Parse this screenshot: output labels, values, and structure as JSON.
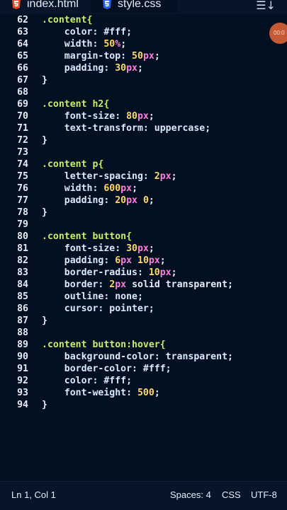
{
  "tabs": [
    {
      "label": "index.html",
      "icon": "html5-icon",
      "active": false
    },
    {
      "label": "style.css",
      "icon": "css3-icon",
      "active": true
    }
  ],
  "colors": {
    "html_icon": "#e44d26",
    "css_icon": "#2965f1",
    "selector": "#c6ef71",
    "number": "#ffd866",
    "unit": "#ff7edb",
    "record": "#c65a34"
  },
  "recording": {
    "time": "00:0"
  },
  "code": [
    {
      "n": "62",
      "tokens": [
        {
          "t": ".content{",
          "c": "sel"
        }
      ]
    },
    {
      "n": "63",
      "tokens": [
        {
          "t": "    color: #fff;",
          "c": "prop"
        }
      ]
    },
    {
      "n": "64",
      "tokens": [
        {
          "t": "    width: ",
          "c": "prop"
        },
        {
          "t": "50",
          "c": "num"
        },
        {
          "t": "%",
          "c": "unit"
        },
        {
          "t": ";",
          "c": "punc"
        }
      ]
    },
    {
      "n": "65",
      "tokens": [
        {
          "t": "    margin-top: ",
          "c": "prop"
        },
        {
          "t": "50",
          "c": "num"
        },
        {
          "t": "px",
          "c": "unit"
        },
        {
          "t": ";",
          "c": "punc"
        }
      ]
    },
    {
      "n": "66",
      "tokens": [
        {
          "t": "    padding: ",
          "c": "prop"
        },
        {
          "t": "30",
          "c": "num"
        },
        {
          "t": "px",
          "c": "unit"
        },
        {
          "t": ";",
          "c": "punc"
        }
      ]
    },
    {
      "n": "67",
      "tokens": [
        {
          "t": "}",
          "c": "punc"
        }
      ]
    },
    {
      "n": "68",
      "tokens": []
    },
    {
      "n": "69",
      "tokens": [
        {
          "t": ".content h2{",
          "c": "sel"
        }
      ]
    },
    {
      "n": "70",
      "tokens": [
        {
          "t": "    font-size: ",
          "c": "prop"
        },
        {
          "t": "80",
          "c": "num"
        },
        {
          "t": "px",
          "c": "unit"
        },
        {
          "t": ";",
          "c": "punc"
        }
      ]
    },
    {
      "n": "71",
      "tokens": [
        {
          "t": "    text-transform: uppercase;",
          "c": "prop"
        }
      ]
    },
    {
      "n": "72",
      "tokens": [
        {
          "t": "}",
          "c": "punc"
        }
      ]
    },
    {
      "n": "73",
      "tokens": []
    },
    {
      "n": "74",
      "tokens": [
        {
          "t": ".content p{",
          "c": "sel"
        }
      ]
    },
    {
      "n": "75",
      "tokens": [
        {
          "t": "    letter-spacing: ",
          "c": "prop"
        },
        {
          "t": "2",
          "c": "num"
        },
        {
          "t": "px",
          "c": "unit"
        },
        {
          "t": ";",
          "c": "punc"
        }
      ]
    },
    {
      "n": "76",
      "tokens": [
        {
          "t": "    width: ",
          "c": "prop"
        },
        {
          "t": "600",
          "c": "num"
        },
        {
          "t": "px",
          "c": "unit"
        },
        {
          "t": ";",
          "c": "punc"
        }
      ]
    },
    {
      "n": "77",
      "tokens": [
        {
          "t": "    padding: ",
          "c": "prop"
        },
        {
          "t": "20",
          "c": "num"
        },
        {
          "t": "px",
          "c": "unit"
        },
        {
          "t": " ",
          "c": "punc"
        },
        {
          "t": "0",
          "c": "num"
        },
        {
          "t": ";",
          "c": "punc"
        }
      ]
    },
    {
      "n": "78",
      "tokens": [
        {
          "t": "}",
          "c": "punc"
        }
      ]
    },
    {
      "n": "79",
      "tokens": []
    },
    {
      "n": "80",
      "tokens": [
        {
          "t": ".content button{",
          "c": "sel"
        }
      ]
    },
    {
      "n": "81",
      "tokens": [
        {
          "t": "    font-size: ",
          "c": "prop"
        },
        {
          "t": "30",
          "c": "num"
        },
        {
          "t": "px",
          "c": "unit"
        },
        {
          "t": ";",
          "c": "punc"
        }
      ]
    },
    {
      "n": "82",
      "tokens": [
        {
          "t": "    padding: ",
          "c": "prop"
        },
        {
          "t": "6",
          "c": "num"
        },
        {
          "t": "px",
          "c": "unit"
        },
        {
          "t": " ",
          "c": "punc"
        },
        {
          "t": "10",
          "c": "num"
        },
        {
          "t": "px",
          "c": "unit"
        },
        {
          "t": ";",
          "c": "punc"
        }
      ]
    },
    {
      "n": "83",
      "tokens": [
        {
          "t": "    border-radius: ",
          "c": "prop"
        },
        {
          "t": "10",
          "c": "num"
        },
        {
          "t": "px",
          "c": "unit"
        },
        {
          "t": ";",
          "c": "punc"
        }
      ]
    },
    {
      "n": "84",
      "tokens": [
        {
          "t": "    border: ",
          "c": "prop"
        },
        {
          "t": "2",
          "c": "num"
        },
        {
          "t": "px",
          "c": "unit"
        },
        {
          "t": " solid transparent;",
          "c": "val"
        }
      ]
    },
    {
      "n": "85",
      "tokens": [
        {
          "t": "    outline: none;",
          "c": "prop"
        }
      ]
    },
    {
      "n": "86",
      "tokens": [
        {
          "t": "    cursor: pointer;",
          "c": "prop"
        }
      ]
    },
    {
      "n": "87",
      "tokens": [
        {
          "t": "}",
          "c": "punc"
        }
      ]
    },
    {
      "n": "88",
      "tokens": []
    },
    {
      "n": "89",
      "tokens": [
        {
          "t": ".content button:hover{",
          "c": "sel"
        }
      ]
    },
    {
      "n": "90",
      "tokens": [
        {
          "t": "    background-color: transparent;",
          "c": "prop"
        }
      ]
    },
    {
      "n": "91",
      "tokens": [
        {
          "t": "    border-color: #fff;",
          "c": "prop"
        }
      ]
    },
    {
      "n": "92",
      "tokens": [
        {
          "t": "    color: #fff;",
          "c": "prop"
        }
      ]
    },
    {
      "n": "93",
      "tokens": [
        {
          "t": "    font-weight: ",
          "c": "prop"
        },
        {
          "t": "500",
          "c": "num"
        },
        {
          "t": ";",
          "c": "punc"
        }
      ]
    },
    {
      "n": "94",
      "tokens": [
        {
          "t": "}",
          "c": "punc"
        }
      ]
    }
  ],
  "status": {
    "position": "Ln 1, Col 1",
    "spaces": "Spaces: 4",
    "language": "CSS",
    "encoding": "UTF-8"
  }
}
